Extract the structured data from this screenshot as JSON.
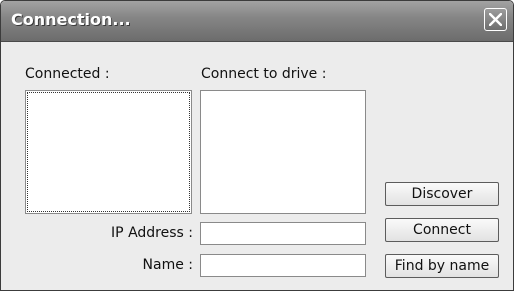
{
  "window": {
    "title": "Connection...",
    "close_icon": "close-icon"
  },
  "labels": {
    "connected": "Connected :",
    "connect_to_drive": "Connect to drive :",
    "ip_address": "IP Address :",
    "name": "Name :"
  },
  "inputs": {
    "ip_address_value": "",
    "name_value": ""
  },
  "buttons": {
    "discover": "Discover",
    "connect": "Connect",
    "find_by_name": "Find by name"
  },
  "colors": {
    "titlebar": "#868686",
    "background": "#ececec"
  }
}
